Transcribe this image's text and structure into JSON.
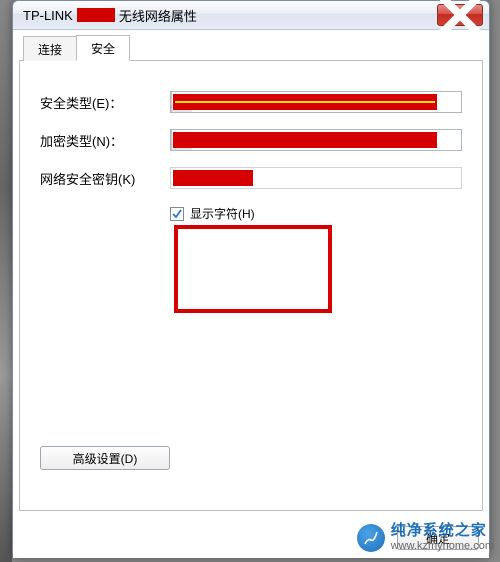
{
  "window": {
    "title_prefix": "TP-LINK",
    "title_suffix": "无线网络属性"
  },
  "tabs": {
    "connect": "连接",
    "security": "安全"
  },
  "labels": {
    "security_type": "安全类型(E)：",
    "encryption_type": "加密类型(N)：",
    "network_key": "网络安全密钥(K)",
    "show_chars": "显示字符(H)",
    "advanced": "高级设置(D)",
    "ok": "确定"
  },
  "checkbox": {
    "show_chars_checked": true
  },
  "watermark": {
    "name": "纯净系统之家",
    "url": "www.kzmyhome.com"
  }
}
